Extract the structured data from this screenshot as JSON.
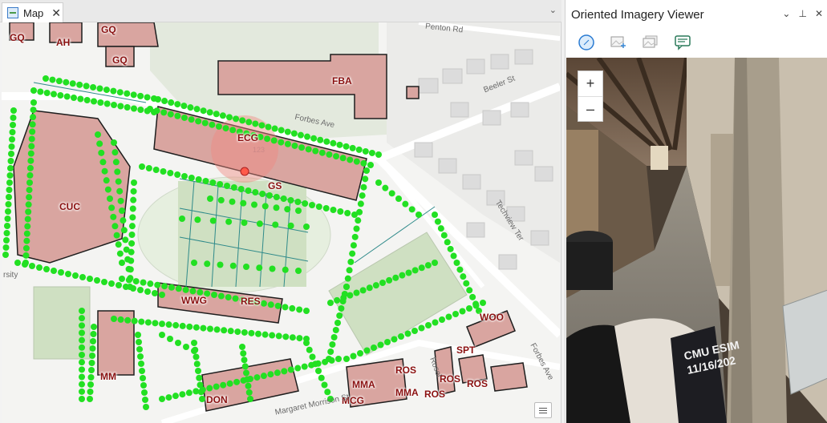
{
  "map_tab": {
    "title": "Map",
    "close_symbol": "✕",
    "dropdown_symbol": "⌄"
  },
  "map": {
    "building_labels": [
      "GQ",
      "AH",
      "GQ",
      "GQ",
      "FBA",
      "ECG",
      "GS",
      "CUC",
      "WWG",
      "RES",
      "MM",
      "DON",
      "MMA",
      "MCG",
      "ROS",
      "MMA",
      "ROS",
      "ROS",
      "ROS",
      "SPT",
      "WOO"
    ],
    "street_labels": [
      "Forbes Ave",
      "Beeler St",
      "Penton Rd",
      "Techview Ter",
      "Forbes Ave",
      "Margaret Morrison St",
      "Rosel",
      "rsity",
      "123"
    ],
    "point_color": "#22e022",
    "building_color": "#d9a5a0"
  },
  "oiv": {
    "title": "Oriented Imagery Viewer",
    "controls": {
      "options": "⌄",
      "pin": "⊥",
      "close": "✕"
    },
    "zoom_in": "+",
    "zoom_out": "–",
    "photo_overlay_text": [
      "CMU ESIM",
      "11/16/202"
    ]
  }
}
